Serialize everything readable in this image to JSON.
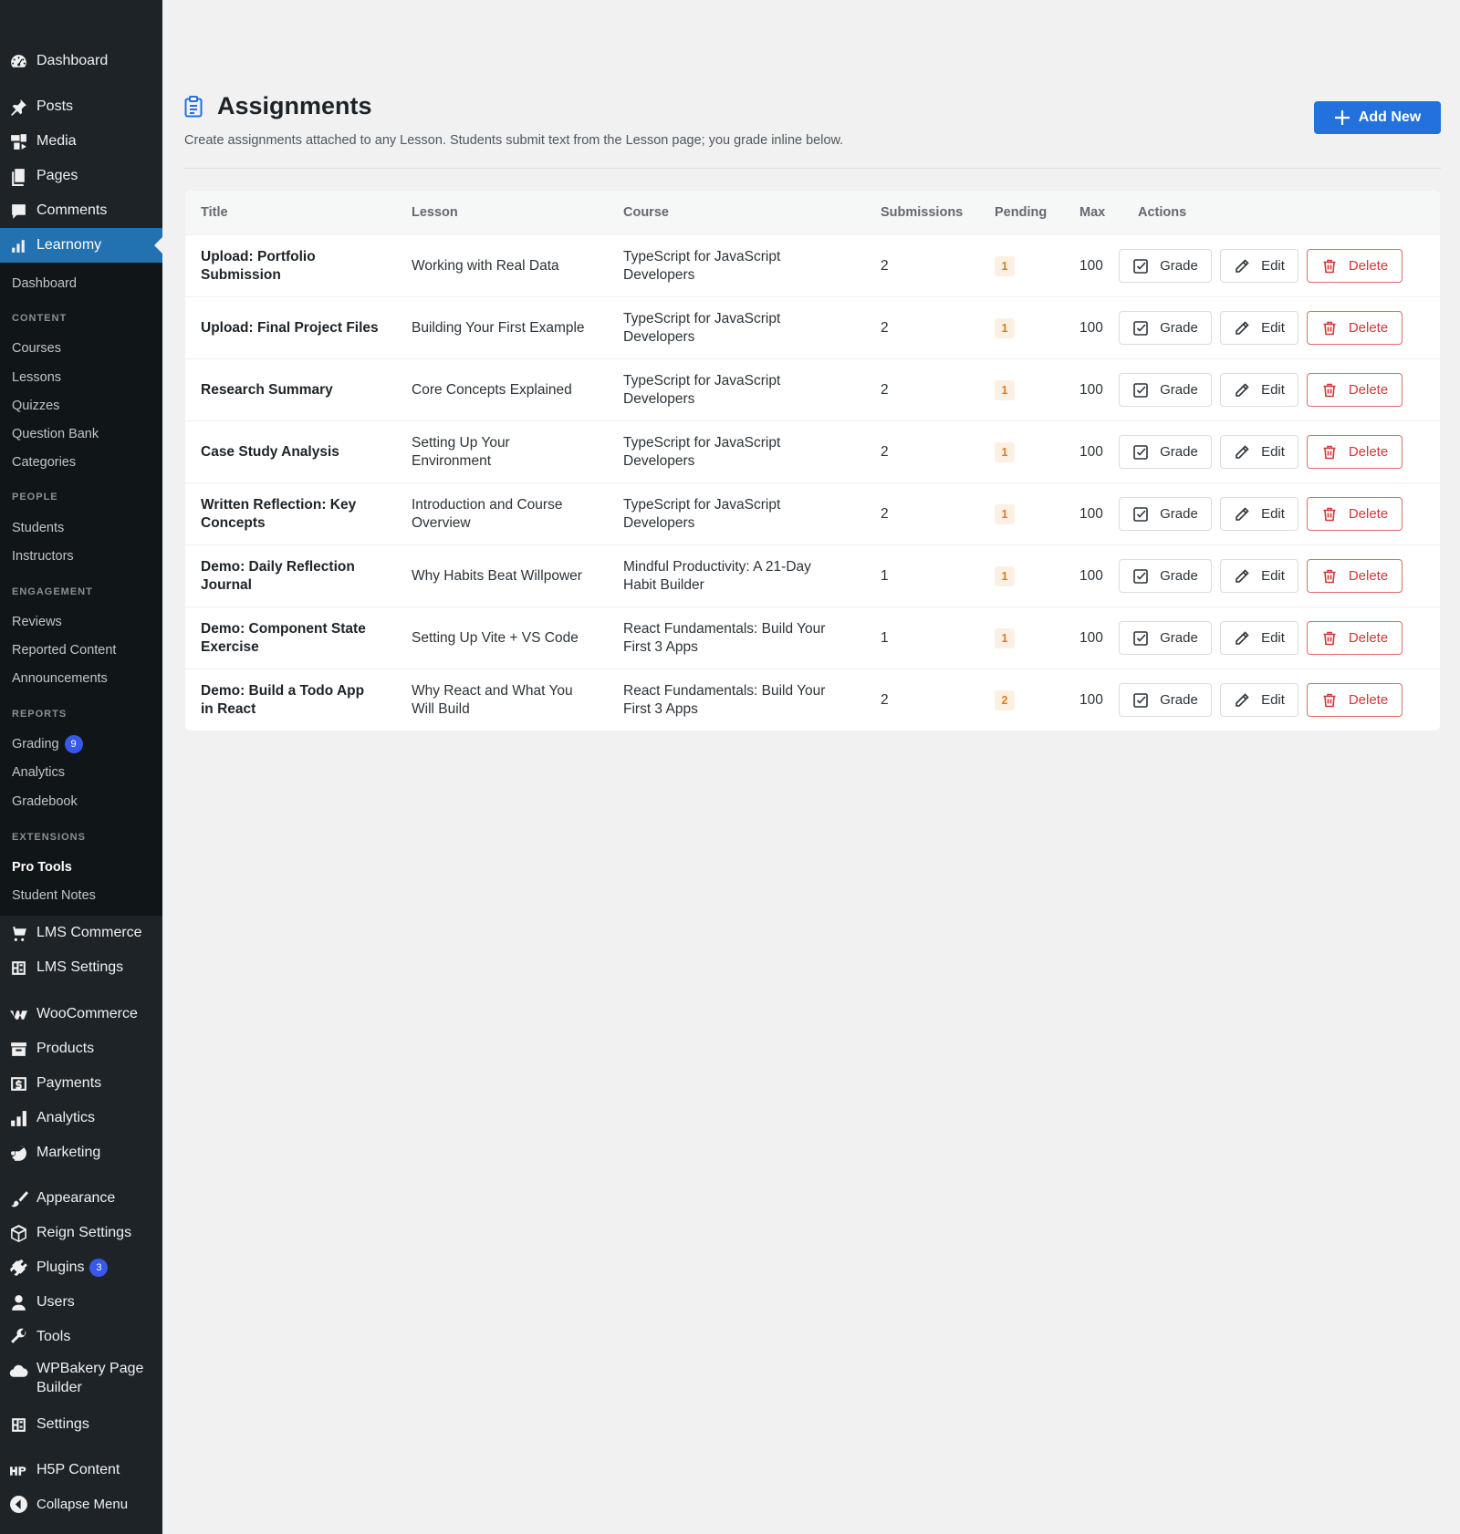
{
  "sidebar": {
    "top": [
      {
        "label": "Dashboard",
        "icon": "dashboard-icon"
      },
      {
        "label": "Posts",
        "icon": "pin-icon"
      },
      {
        "label": "Media",
        "icon": "media-icon"
      },
      {
        "label": "Pages",
        "icon": "pages-icon"
      },
      {
        "label": "Comments",
        "icon": "comment-icon"
      },
      {
        "label": "Learnomy",
        "icon": "chart-icon"
      }
    ],
    "submenu": {
      "dashboard": "Dashboard",
      "content_heading": "CONTENT",
      "courses": "Courses",
      "lessons": "Lessons",
      "quizzes": "Quizzes",
      "question_bank": "Question Bank",
      "categories": "Categories",
      "people_heading": "PEOPLE",
      "students": "Students",
      "instructors": "Instructors",
      "engagement_heading": "ENGAGEMENT",
      "reviews": "Reviews",
      "reported_content": "Reported Content",
      "announcements": "Announcements",
      "reports_heading": "REPORTS",
      "grading": "Grading",
      "grading_count": "9",
      "analytics": "Analytics",
      "gradebook": "Gradebook",
      "extensions_heading": "EXTENSIONS",
      "pro_tools": "Pro Tools",
      "student_notes": "Student Notes"
    },
    "bottom": [
      {
        "label": "LMS Commerce",
        "icon": "cart-icon"
      },
      {
        "label": "LMS Settings",
        "icon": "settings-grid-icon"
      },
      {
        "label": "WooCommerce",
        "icon": "woo-icon"
      },
      {
        "label": "Products",
        "icon": "archive-icon"
      },
      {
        "label": "Payments",
        "icon": "dollar-icon"
      },
      {
        "label": "Analytics",
        "icon": "bar-chart-icon"
      },
      {
        "label": "Marketing",
        "icon": "megaphone-icon"
      },
      {
        "label": "Appearance",
        "icon": "brush-icon"
      },
      {
        "label": "Reign Settings",
        "icon": "cube-icon"
      },
      {
        "label": "Plugins",
        "icon": "plug-icon",
        "badge": "3"
      },
      {
        "label": "Users",
        "icon": "user-icon"
      },
      {
        "label": "Tools",
        "icon": "wrench-icon"
      },
      {
        "label": "WPBakery Page",
        "label2": "Builder",
        "icon": "cloud-icon"
      },
      {
        "label": "Settings",
        "icon": "settings-grid-icon"
      },
      {
        "label": "H5P Content",
        "icon": "h5p-icon"
      },
      {
        "label": "Collapse Menu",
        "icon": "collapse-icon"
      }
    ]
  },
  "header": {
    "title": "Assignments",
    "description": "Create assignments attached to any Lesson. Students submit text from the Lesson page; you grade inline below.",
    "add_new_label": "Add New"
  },
  "table": {
    "columns": [
      "Title",
      "Lesson",
      "Course",
      "Submissions",
      "Pending",
      "Max",
      "Actions"
    ],
    "actions": {
      "grade": "Grade",
      "edit": "Edit",
      "delete": "Delete"
    },
    "rows": [
      {
        "title": [
          "Upload: Portfolio",
          "Submission"
        ],
        "lesson": [
          "Working with Real Data"
        ],
        "course": [
          "TypeScript for JavaScript",
          "Developers"
        ],
        "submissions": "2",
        "pending": "1",
        "max": "100"
      },
      {
        "title": [
          "Upload: Final Project Files"
        ],
        "lesson": [
          "Building Your First Example"
        ],
        "course": [
          "TypeScript for JavaScript",
          "Developers"
        ],
        "submissions": "2",
        "pending": "1",
        "max": "100"
      },
      {
        "title": [
          "Research Summary"
        ],
        "lesson": [
          "Core Concepts Explained"
        ],
        "course": [
          "TypeScript for JavaScript",
          "Developers"
        ],
        "submissions": "2",
        "pending": "1",
        "max": "100"
      },
      {
        "title": [
          "Case Study Analysis"
        ],
        "lesson": [
          "Setting Up Your",
          "Environment"
        ],
        "course": [
          "TypeScript for JavaScript",
          "Developers"
        ],
        "submissions": "2",
        "pending": "1",
        "max": "100"
      },
      {
        "title": [
          "Written Reflection: Key",
          "Concepts"
        ],
        "lesson": [
          "Introduction and Course",
          "Overview"
        ],
        "course": [
          "TypeScript for JavaScript",
          "Developers"
        ],
        "submissions": "2",
        "pending": "1",
        "max": "100"
      },
      {
        "title": [
          "Demo: Daily Reflection",
          "Journal"
        ],
        "lesson": [
          "Why Habits Beat Willpower"
        ],
        "course": [
          "Mindful Productivity: A 21-Day",
          "Habit Builder"
        ],
        "submissions": "1",
        "pending": "1",
        "max": "100"
      },
      {
        "title": [
          "Demo: Component State",
          "Exercise"
        ],
        "lesson": [
          "Setting Up Vite + VS Code"
        ],
        "course": [
          "React Fundamentals: Build Your",
          "First 3 Apps"
        ],
        "submissions": "1",
        "pending": "1",
        "max": "100"
      },
      {
        "title": [
          "Demo: Build a Todo App",
          "in React"
        ],
        "lesson": [
          "Why React and What You",
          "Will Build"
        ],
        "course": [
          "React Fundamentals: Build Your",
          "First 3 Apps"
        ],
        "submissions": "2",
        "pending": "2",
        "max": "100"
      }
    ]
  },
  "colors": {
    "accent": "#2271b1",
    "button_primary": "#2271dc",
    "danger": "#d63638",
    "pending_bg": "#fcf0e3",
    "pending_text": "#e6791c"
  }
}
